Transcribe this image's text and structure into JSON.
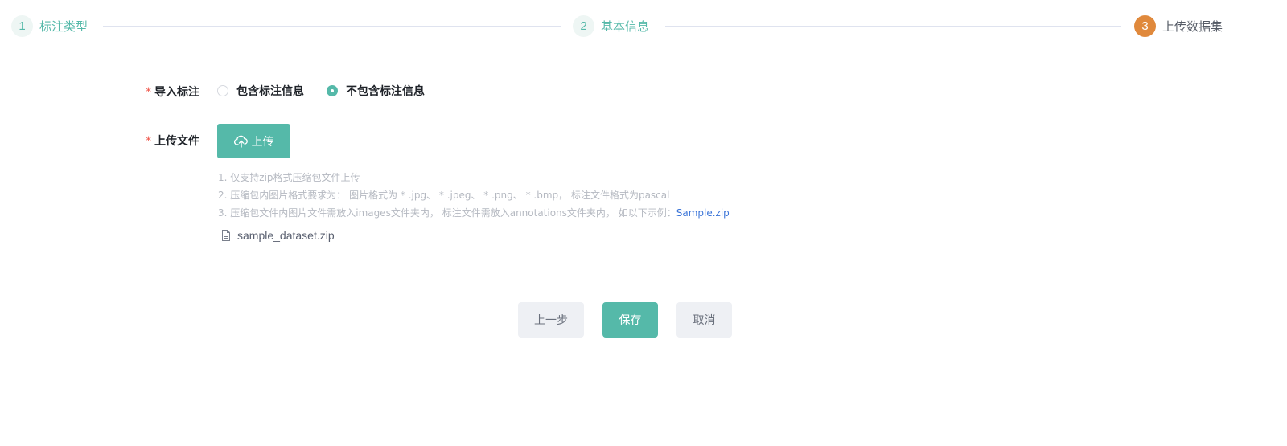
{
  "steps": [
    {
      "num": "1",
      "title": "标注类型",
      "state": "done"
    },
    {
      "num": "2",
      "title": "基本信息",
      "state": "done"
    },
    {
      "num": "3",
      "title": "上传数据集",
      "state": "active"
    }
  ],
  "form": {
    "required_mark": "*",
    "import_label": "导入标注",
    "import_options": [
      {
        "label": "包含标注信息",
        "checked": false
      },
      {
        "label": "不包含标注信息",
        "checked": true
      }
    ],
    "upload_label": "上传文件",
    "upload_button": "上传",
    "tips": {
      "line1": "1. 仅支持zip格式压缩包文件上传",
      "line2": "2. 压缩包内图片格式要求为： 图片格式为 * .jpg、 * .jpeg、 * .png、 * .bmp， 标注文件格式为pascal",
      "line3": "3. 压缩包文件内图片文件需放入images文件夹内， 标注文件需放入annotations文件夹内， 如以下示例：",
      "sample_link": "Sample.zip"
    },
    "uploaded_file": "sample_dataset.zip"
  },
  "footer": {
    "prev_label": "上一步",
    "save_label": "保存",
    "cancel_label": "取消"
  },
  "colors": {
    "accent": "#55b9a9",
    "active_step": "#e0893c",
    "required": "#f0564a",
    "link": "#3a74d8"
  },
  "icons": {
    "upload": "cloud-upload-icon",
    "file": "document-icon"
  }
}
